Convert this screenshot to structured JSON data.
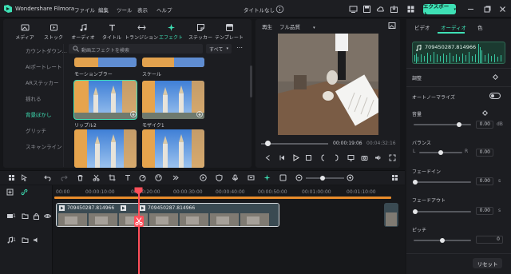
{
  "app": {
    "name": "Wondershare Filmora",
    "project_title": "タイトルなし"
  },
  "menu": [
    "ファイル",
    "編集",
    "ツール",
    "表示",
    "ヘルプ"
  ],
  "export_label": "エクスポート",
  "media_tabs": [
    {
      "label": "メディア",
      "icon": "media-icon"
    },
    {
      "label": "ストック",
      "icon": "stock-icon"
    },
    {
      "label": "オーディオ",
      "icon": "music-note-icon"
    },
    {
      "label": "タイトル",
      "icon": "text-t-icon"
    },
    {
      "label": "トランジション",
      "icon": "transition-icon"
    },
    {
      "label": "エフェクト",
      "icon": "effect-sparkle-icon"
    },
    {
      "label": "ステッカー",
      "icon": "sticker-icon"
    },
    {
      "label": "テンプレート",
      "icon": "template-icon"
    }
  ],
  "active_media_tab": "エフェクト",
  "categories": [
    "カウントダウン…",
    "AIポートレート",
    "ARステッカー",
    "揺れる",
    "背景ぼかし",
    "グリッチ",
    "スキャンライン"
  ],
  "active_category": "背景ぼかし",
  "search": {
    "placeholder": "動画エフェクトを検索"
  },
  "sort": {
    "selected": "すべて"
  },
  "effects": [
    {
      "label": "モーションブラー"
    },
    {
      "label": "スケール"
    },
    {
      "label": "リップル2",
      "selected": true
    },
    {
      "label": "モザイク1"
    },
    {
      "label": ""
    },
    {
      "label": ""
    }
  ],
  "preview": {
    "label": "再生",
    "quality": "フル品質",
    "current_time": "00:00:19:06",
    "separator": "/",
    "total_time": "00:04:32:16",
    "progress": 0.07
  },
  "right_panel": {
    "tabs": [
      "ビデオ",
      "オーディオ",
      "色"
    ],
    "active_tab": "オーディオ",
    "clip_name": "709450287.814966",
    "sections": {
      "adjust": "調整",
      "auto_normalize": "オートノーマライズ",
      "volume": "音量",
      "volume_value": "0.00",
      "volume_unit": "dB",
      "balance": "バランス",
      "balance_left": "L",
      "balance_right": "R",
      "balance_value": "0.00",
      "fade_in": "フェードイン",
      "fade_in_value": "0.00",
      "fade_in_unit": "s",
      "fade_out": "フェードアウト",
      "fade_out_value": "0.00",
      "fade_out_unit": "s",
      "pitch": "ピッチ",
      "pitch_value": "0"
    },
    "reset_label": "リセット"
  },
  "timeline": {
    "ruler": [
      "00:00",
      "00:00:10:00",
      "00:00:20:00",
      "00:00:30:00",
      "00:00:40:00",
      "00:00:50:00",
      "00:01:00:00",
      "00:01:10:00"
    ],
    "clip_label": "709450287.814966",
    "clip_label_2": "709450287.814966",
    "track_video_num": "1",
    "track_audio_num": "1"
  },
  "colors": {
    "accent": "#3ee0b5",
    "playhead": "#ff4f5a",
    "ruler_bar": "#e98c2b"
  }
}
